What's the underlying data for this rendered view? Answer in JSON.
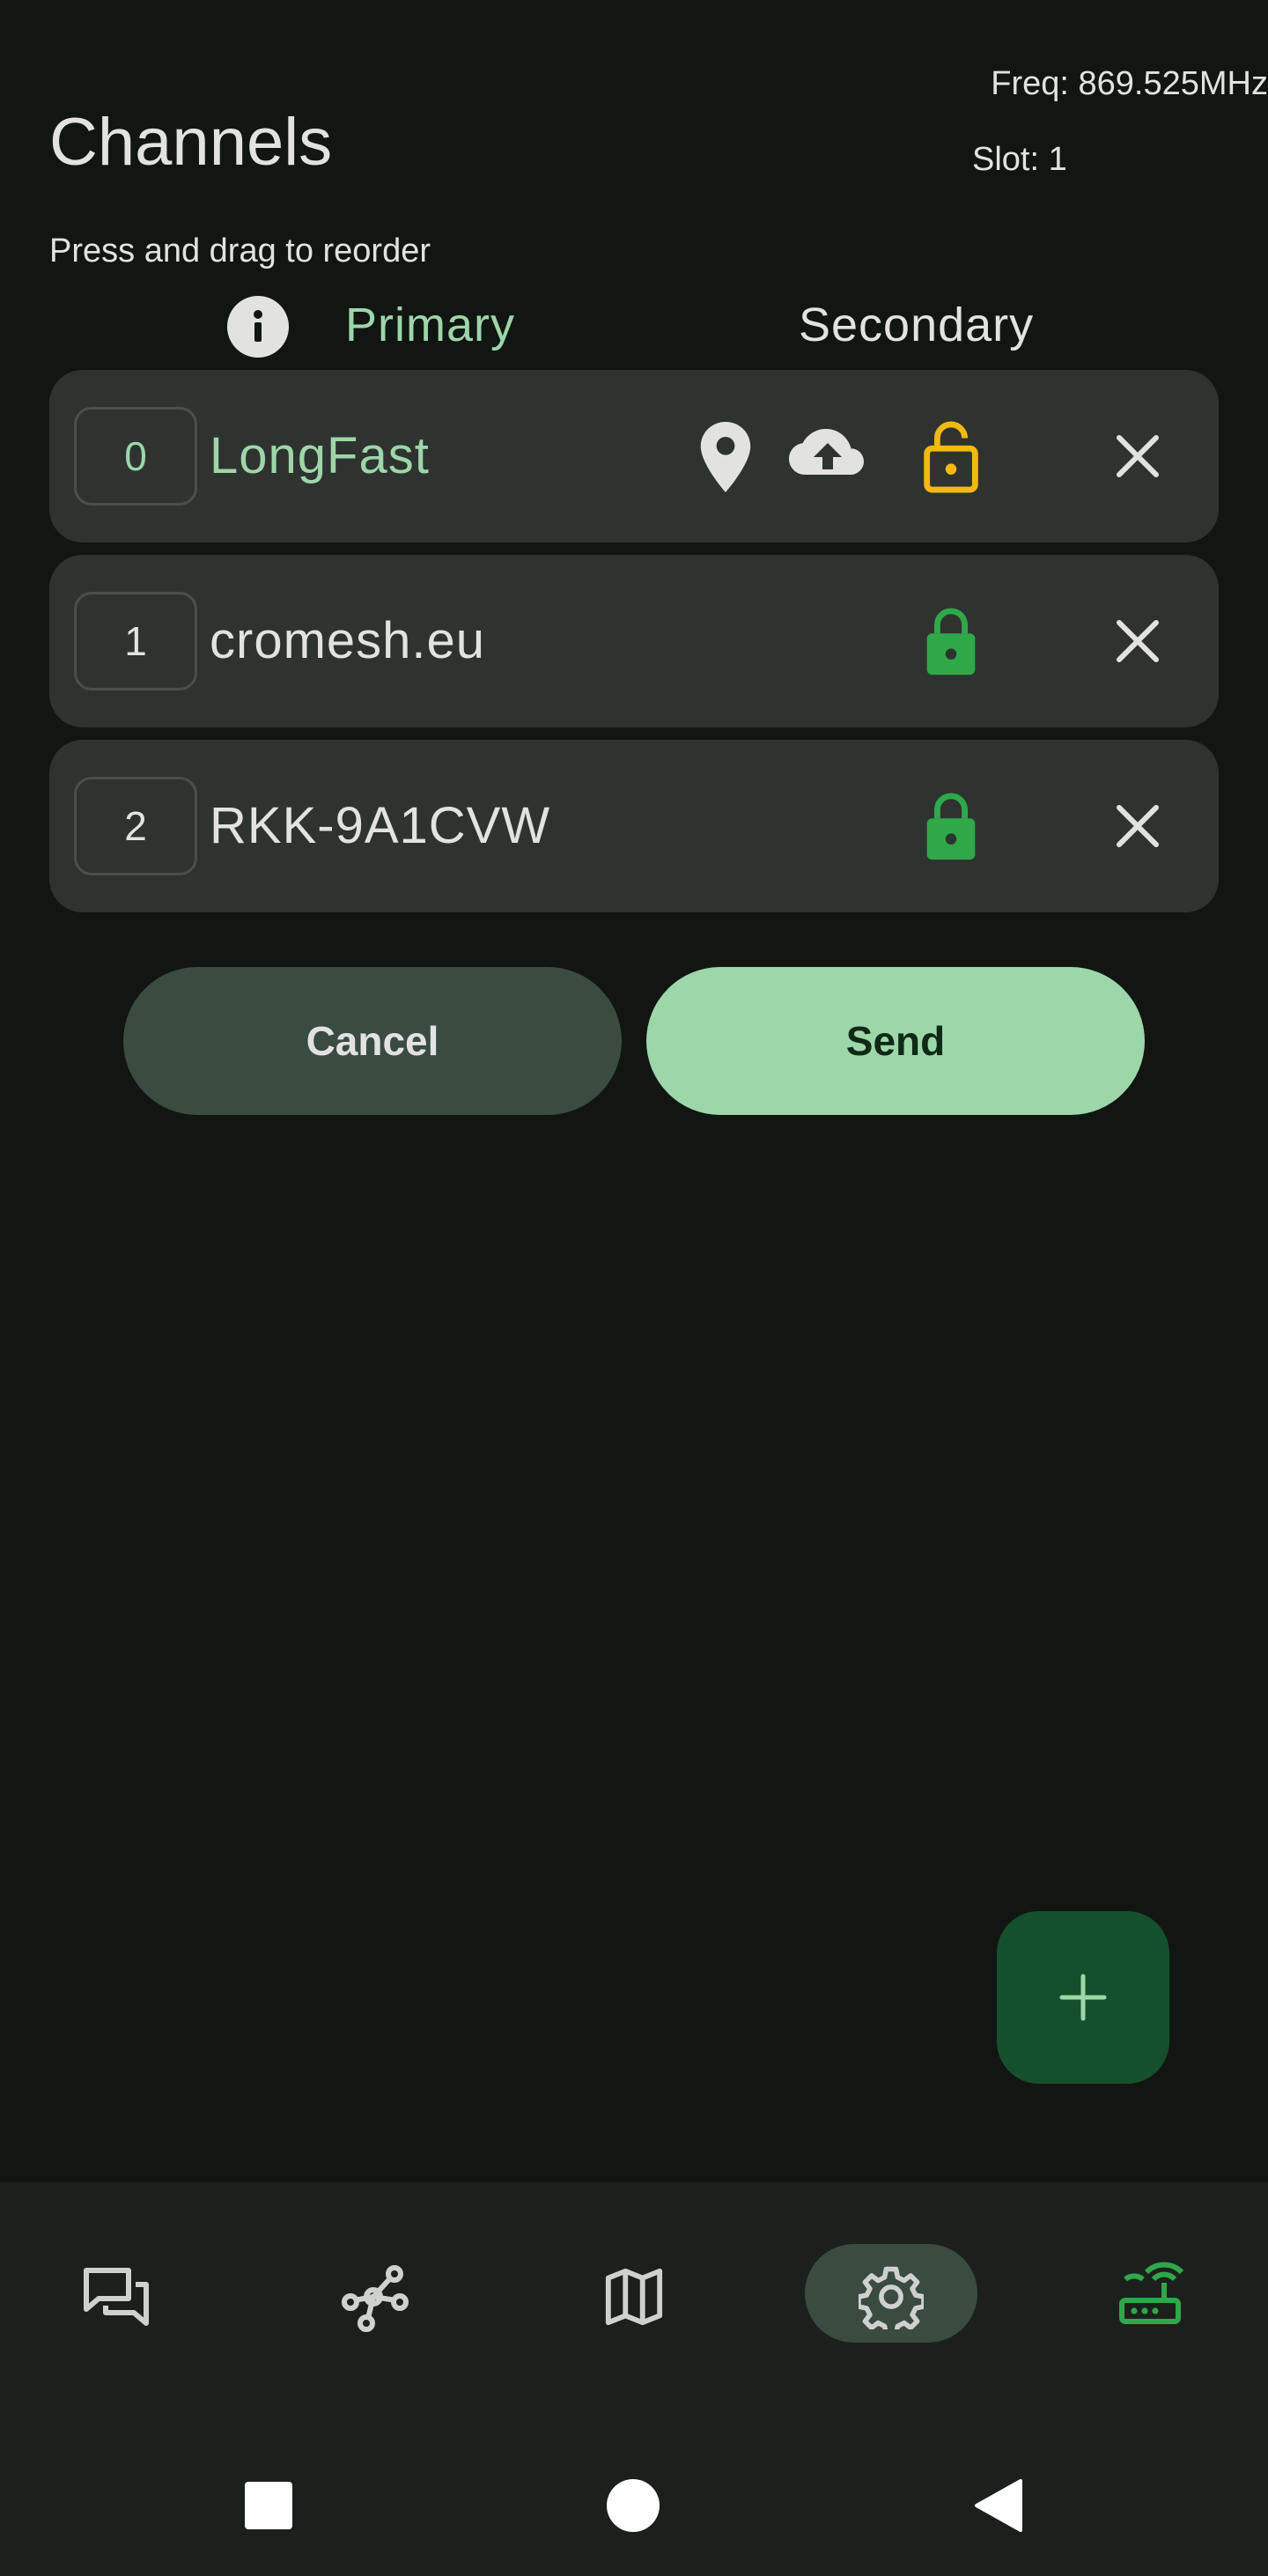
{
  "header": {
    "title": "Channels",
    "freq": "Freq: 869.525MHz",
    "slot": "Slot: 1",
    "hint": "Press and drag to reorder"
  },
  "columns": {
    "primary": "Primary",
    "secondary": "Secondary"
  },
  "channels": [
    {
      "index": "0",
      "name": "LongFast",
      "primary": true,
      "lock": "unlocked",
      "lock_color": "#f2b90f",
      "icons": [
        "location-icon",
        "cloud-upload-icon",
        "lock-open-icon",
        "close-icon"
      ]
    },
    {
      "index": "1",
      "name": "cromesh.eu",
      "primary": false,
      "lock": "locked",
      "lock_color": "#2fa84a",
      "icons": [
        "lock-icon",
        "close-icon"
      ]
    },
    {
      "index": "2",
      "name": "RKK-9A1CVW",
      "primary": false,
      "lock": "locked",
      "lock_color": "#2fa84a",
      "icons": [
        "lock-icon",
        "close-icon"
      ]
    }
  ],
  "actions": {
    "cancel": "Cancel",
    "send": "Send"
  },
  "fab": {
    "icon": "plus-icon"
  },
  "nav": {
    "items": [
      "conversations-icon",
      "nodes-icon",
      "map-icon",
      "settings-icon",
      "connection-icon"
    ],
    "active": "settings-icon"
  },
  "system_bar": [
    "recents-icon",
    "home-icon",
    "back-icon"
  ],
  "colors": {
    "background": "#111612",
    "card": "#2f3330",
    "accent": "#9dd6a9",
    "fab": "#15502c",
    "lock_locked": "#2fa84a",
    "lock_unlocked": "#f2b90f",
    "connected": "#2fa84a"
  }
}
